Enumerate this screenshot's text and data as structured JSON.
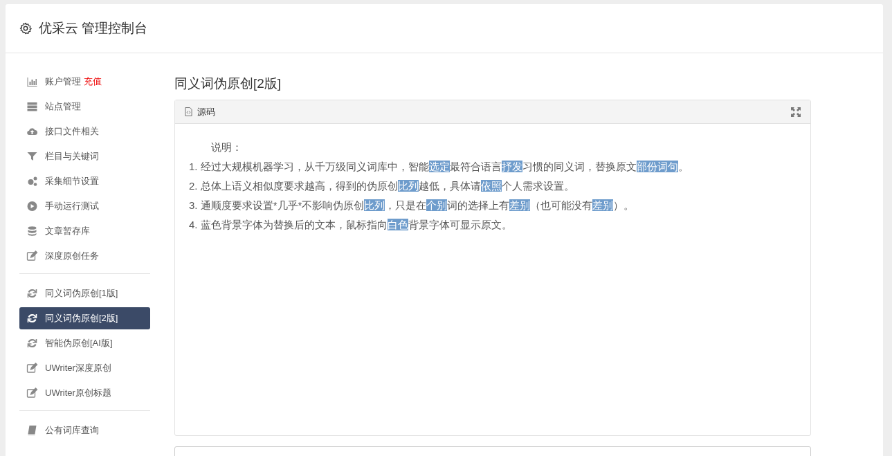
{
  "header": {
    "title": "优采云 管理控制台"
  },
  "sidebar": {
    "groups": [
      {
        "items": [
          {
            "label": "账户管理",
            "badge": "充值",
            "selected": false
          },
          {
            "label": "站点管理",
            "selected": false
          },
          {
            "label": "接口文件相关",
            "selected": false
          },
          {
            "label": "栏目与关键词",
            "selected": false
          },
          {
            "label": "采集细节设置",
            "selected": false
          },
          {
            "label": "手动运行测试",
            "selected": false
          },
          {
            "label": "文章暂存库",
            "selected": false
          },
          {
            "label": "深度原创任务",
            "selected": false
          }
        ]
      },
      {
        "items": [
          {
            "label": "同义词伪原创[1版]",
            "selected": false
          },
          {
            "label": "同义词伪原创[2版]",
            "selected": true
          },
          {
            "label": "智能伪原创[AI版]",
            "selected": false
          },
          {
            "label": "UWriter深度原创",
            "selected": false
          },
          {
            "label": "UWriter原创标题",
            "selected": false
          }
        ]
      },
      {
        "items": [
          {
            "label": "公有词库查询",
            "selected": false
          }
        ]
      }
    ]
  },
  "main": {
    "heading": "同义词伪原创[2版]",
    "panel": {
      "tab": "源码",
      "intro": "说明：",
      "lines": [
        [
          {
            "text": "1. 经过大规模机器学习，从千万级同义词库中，智能",
            "highlighted": false
          },
          {
            "text": "选定",
            "highlighted": true
          },
          {
            "text": "最符合语言",
            "highlighted": false
          },
          {
            "text": "抒发",
            "highlighted": true
          },
          {
            "text": "习惯的同义词，替换原文",
            "highlighted": false
          },
          {
            "text": "部份",
            "highlighted": true
          },
          {
            "text": "词句",
            "highlighted": true
          },
          {
            "text": "。",
            "highlighted": false
          }
        ],
        [
          {
            "text": "2. 总体上语义相似度要求越高，得到的伪原创",
            "highlighted": false
          },
          {
            "text": "比列",
            "highlighted": true
          },
          {
            "text": "越低，具体请",
            "highlighted": false
          },
          {
            "text": "依照",
            "highlighted": true
          },
          {
            "text": "个人需求设置。",
            "highlighted": false
          }
        ],
        [
          {
            "text": "3. 通顺度要求设置*几乎*不影响伪原创",
            "highlighted": false
          },
          {
            "text": "比列",
            "highlighted": true
          },
          {
            "text": "，只是在",
            "highlighted": false
          },
          {
            "text": "个别",
            "highlighted": true
          },
          {
            "text": "词的选择上有",
            "highlighted": false
          },
          {
            "text": "差别",
            "highlighted": true
          },
          {
            "text": "（也可能没有",
            "highlighted": false
          },
          {
            "text": "差别",
            "highlighted": true
          },
          {
            "text": "）。",
            "highlighted": false
          }
        ],
        [
          {
            "text": "4. 蓝色背景字体为替换后的文本，鼠标指向",
            "highlighted": false
          },
          {
            "text": "白色",
            "highlighted": true
          },
          {
            "text": "背景字体可显示原文。",
            "highlighted": false
          }
        ]
      ]
    }
  }
}
